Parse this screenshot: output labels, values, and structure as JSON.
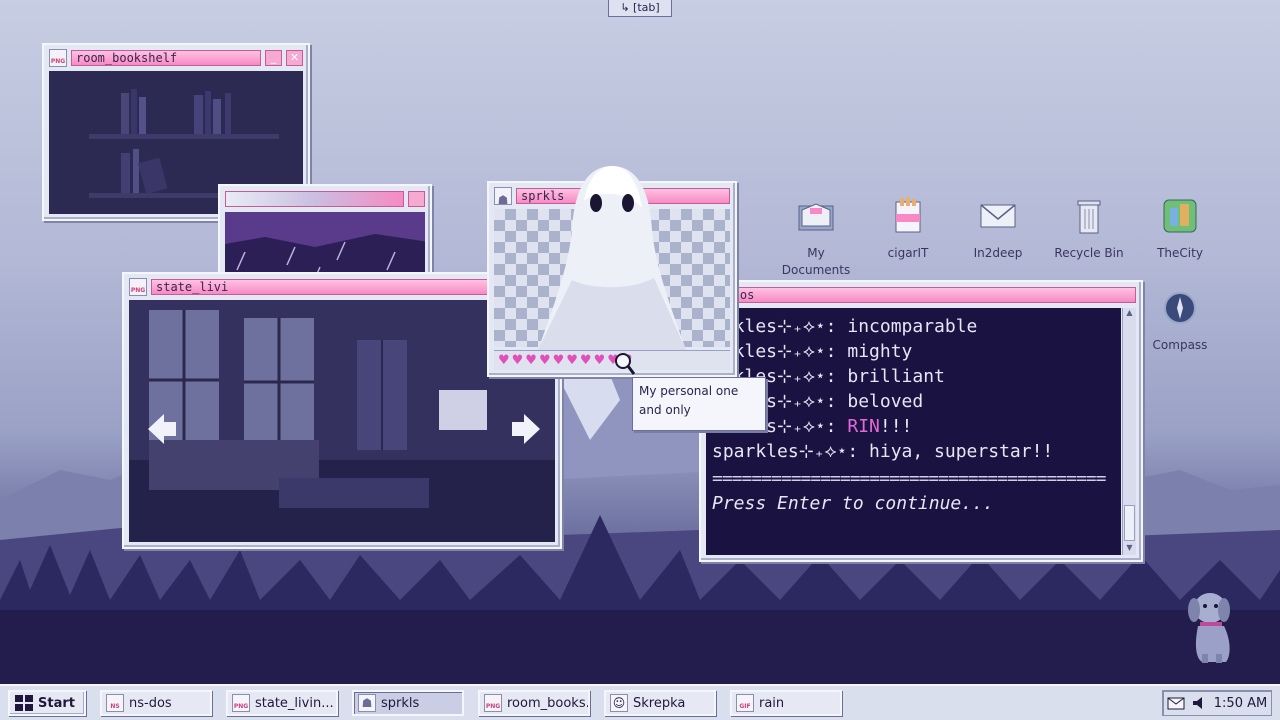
{
  "hint_key": "↳ [tab]",
  "windows": {
    "bookshelf": {
      "title": "room_bookshelf",
      "icon_label": "PNG"
    },
    "living": {
      "title": "state_livi",
      "icon_label": "PNG"
    },
    "ghost": {
      "title": "sprkls",
      "hearts": 10
    },
    "terminal": {
      "title": "ns-dos",
      "lines": [
        {
          "speaker": "arkles⊹₊⟡⋆:",
          "text": " incomparable"
        },
        {
          "speaker": "arkles⊹₊⟡⋆:",
          "text": " mighty"
        },
        {
          "speaker": "arkles⊹₊⟡⋆:",
          "text": " brilliant"
        },
        {
          "speaker": "arkles⊹₊⟡⋆:",
          "text": " beloved"
        },
        {
          "speaker": "arkles⊹₊⟡⋆:",
          "text": " ",
          "highlight": "RIN",
          "tail": "!!!"
        },
        {
          "speaker": "sparkles⊹₊⟡⋆:",
          "text": " hiya, superstar!!"
        }
      ],
      "separator": "========================================",
      "prompt": "Press Enter to continue..."
    }
  },
  "tooltip": {
    "line1": "My personal one",
    "line2": "and only"
  },
  "desktop_icons": [
    {
      "id": "my-documents",
      "label1": "My",
      "label2": "Documents",
      "icon": "folder-icon"
    },
    {
      "id": "cigarit",
      "label1": "cigarIT",
      "label2": "",
      "icon": "cigarette-pack-icon"
    },
    {
      "id": "in2deep",
      "label1": "In2deep",
      "label2": "",
      "icon": "envelope-icon"
    },
    {
      "id": "recycle-bin",
      "label1": "Recycle Bin",
      "label2": "",
      "icon": "trash-icon"
    },
    {
      "id": "thecity",
      "label1": "TheCity",
      "label2": "",
      "icon": "city-icon"
    },
    {
      "id": "compass",
      "label1": "Compass",
      "label2": "",
      "icon": "compass-icon"
    }
  ],
  "taskbar": {
    "start_label": "Start",
    "items": [
      {
        "label": "ns-dos",
        "icon_label": "NS",
        "active": false
      },
      {
        "label": "state_livin...",
        "icon_label": "PNG",
        "active": false
      },
      {
        "label": "sprkls",
        "icon_label": "",
        "active": true
      },
      {
        "label": "room_books...",
        "icon_label": "PNG",
        "active": false
      },
      {
        "label": "Skrepka",
        "icon_label": "",
        "active": false
      },
      {
        "label": "rain",
        "icon_label": "GIF",
        "active": false
      }
    ],
    "clock": "1:50 AM"
  },
  "colors": {
    "accent_pink": "#f78ac4",
    "terminal_bg": "#1a1240",
    "highlight": "#e36ad6"
  }
}
